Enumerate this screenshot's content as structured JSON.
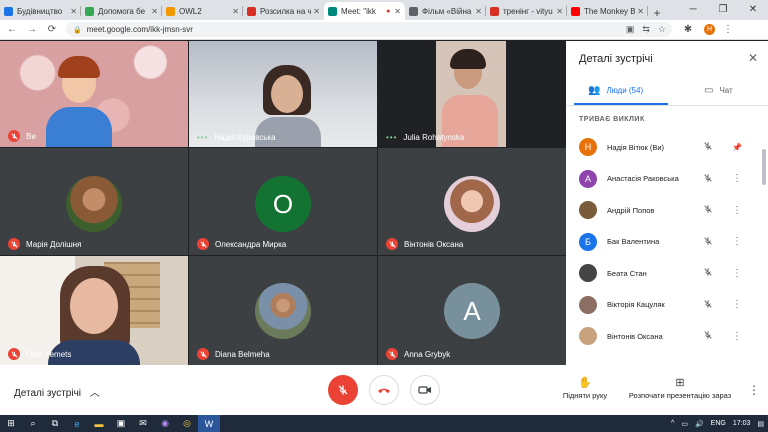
{
  "browser": {
    "tabs": [
      {
        "title": "Будівництво ",
        "color": "#1a73e8"
      },
      {
        "title": "Допомога бе",
        "color": "#34a853"
      },
      {
        "title": "OWL2",
        "color": "#f29900"
      },
      {
        "title": "Розсилка на ч",
        "color": "#d93025"
      },
      {
        "title": "Meet: \"ikk",
        "color": "#00897b"
      },
      {
        "title": "Фільм «Війна",
        "color": "#5f6368"
      },
      {
        "title": "тренінг - vityu",
        "color": "#d93025"
      },
      {
        "title": "The Monkey B",
        "color": "#ff0000"
      }
    ],
    "url": "meet.google.com/ikk-jmsn-svr",
    "profile_initial": "Н"
  },
  "tiles": [
    {
      "name": "Ви",
      "status": "muted"
    },
    {
      "name": "Надія Куравська",
      "status": "speaking"
    },
    {
      "name": "Julia Rohatynska",
      "status": "speaking"
    },
    {
      "name": "Марія Долішня",
      "status": "muted"
    },
    {
      "name": "Олександра Мирка",
      "status": "muted",
      "initial": "О"
    },
    {
      "name": "Вінтонів Оксана",
      "status": "muted"
    },
    {
      "name": "Olha Yemets",
      "status": "muted"
    },
    {
      "name": "Diana Belmeha",
      "status": "muted"
    },
    {
      "name": "Anna Grybyk",
      "status": "muted",
      "initial": "A"
    }
  ],
  "panel": {
    "title": "Деталі зустрічі",
    "people_tab": "Люди (54)",
    "chat_tab": "Чат",
    "section": "ТРИВАЄ ВИКЛИК",
    "people": [
      {
        "name": "Надія Вітюк (Ви)",
        "initial": "Н",
        "color": "#e8710a"
      },
      {
        "name": "Анастасія Раковська",
        "initial": "А",
        "color": "#8e44ad"
      },
      {
        "name": "Андрій Попов",
        "initial": "",
        "color": "#7a5c3a"
      },
      {
        "name": "Бак Валентина",
        "initial": "Б",
        "color": "#1a73e8"
      },
      {
        "name": "Беата Стан",
        "initial": "",
        "color": "#444"
      },
      {
        "name": "Вікторія Кацуляк",
        "initial": "",
        "color": "#8d6e63"
      },
      {
        "name": "Вінтонів Оксана",
        "initial": "",
        "color": "#c9a27e"
      }
    ]
  },
  "bottom": {
    "details_label": "Деталі зустрічі",
    "raise_hand": "Підняти руку",
    "present_now": "Розпочати презентацію зараз"
  },
  "taskbar": {
    "lang": "ENG",
    "time": "17:03"
  }
}
